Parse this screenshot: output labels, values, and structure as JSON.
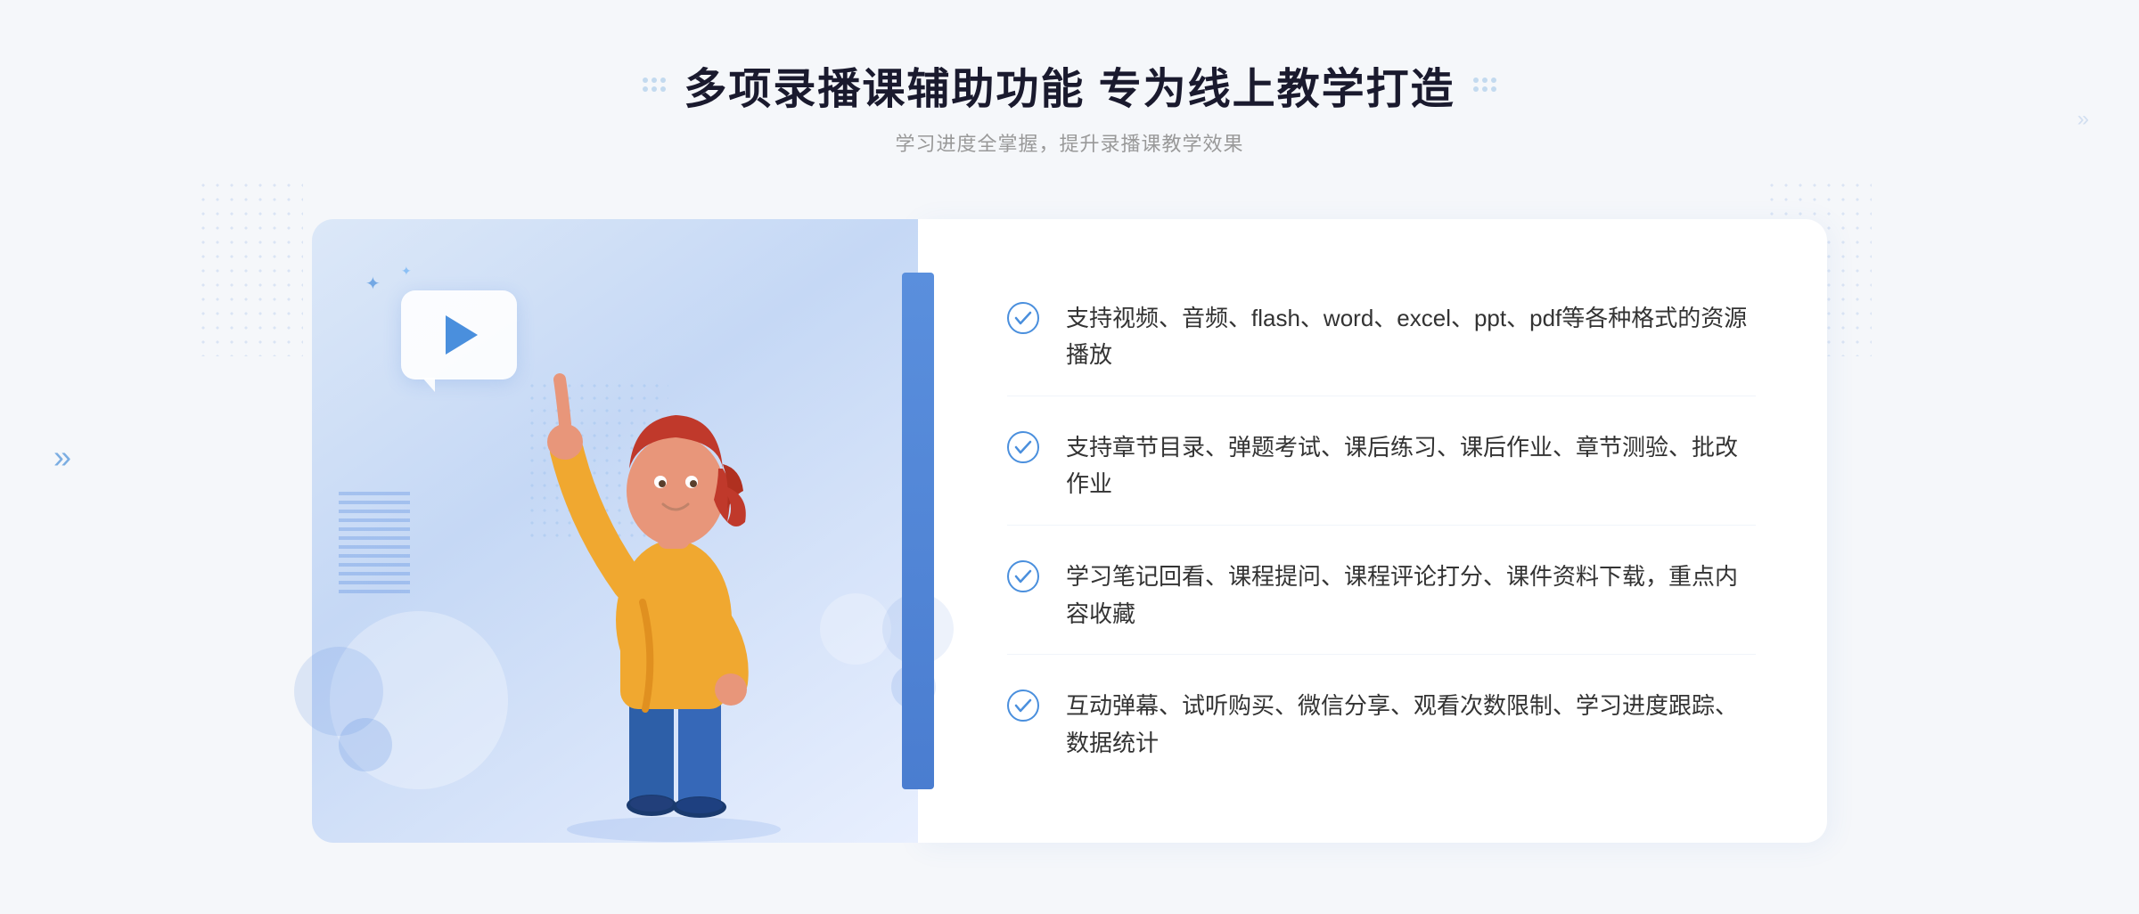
{
  "header": {
    "title": "多项录播课辅助功能 专为线上教学打造",
    "subtitle": "学习进度全掌握，提升录播课教学效果"
  },
  "features": [
    {
      "id": "feature-1",
      "text": "支持视频、音频、flash、word、excel、ppt、pdf等各种格式的资源播放"
    },
    {
      "id": "feature-2",
      "text": "支持章节目录、弹题考试、课后练习、课后作业、章节测验、批改作业"
    },
    {
      "id": "feature-3",
      "text": "学习笔记回看、课程提问、课程评论打分、课件资料下载，重点内容收藏"
    },
    {
      "id": "feature-4",
      "text": "互动弹幕、试听购买、微信分享、观看次数限制、学习进度跟踪、数据统计"
    }
  ],
  "icons": {
    "check": "check-circle",
    "play": "play-triangle",
    "chevron_left": "«",
    "chevron_right": "»"
  },
  "colors": {
    "accent": "#4a8fdd",
    "title": "#1a1a2e",
    "subtitle": "#999999",
    "text": "#333333",
    "bg_panel": "#f5f7fa",
    "check_color": "#4a8fdd"
  }
}
